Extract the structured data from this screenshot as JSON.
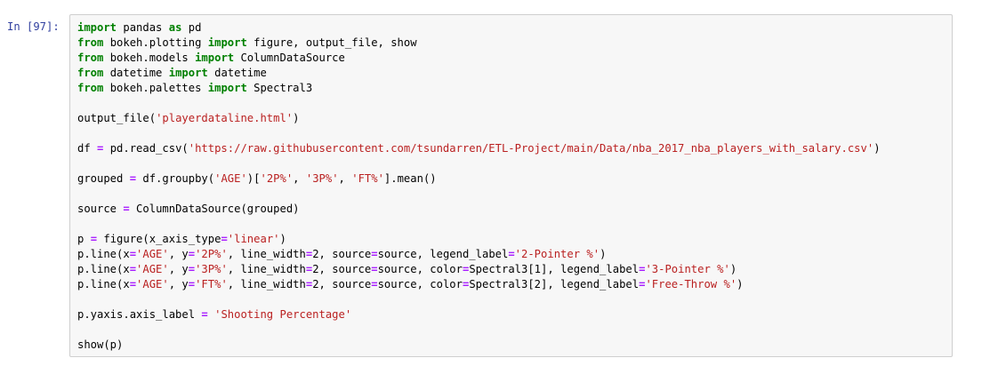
{
  "prompt": "In [97]:",
  "code_lines": [
    {
      "tokens": [
        {
          "t": "import",
          "c": "k"
        },
        {
          "t": " pandas ",
          "c": "n"
        },
        {
          "t": "as",
          "c": "k"
        },
        {
          "t": " pd",
          "c": "n"
        }
      ]
    },
    {
      "tokens": [
        {
          "t": "from",
          "c": "k"
        },
        {
          "t": " bokeh.plotting ",
          "c": "n"
        },
        {
          "t": "import",
          "c": "k"
        },
        {
          "t": " figure, output_file, show",
          "c": "n"
        }
      ]
    },
    {
      "tokens": [
        {
          "t": "from",
          "c": "k"
        },
        {
          "t": " bokeh.models ",
          "c": "n"
        },
        {
          "t": "import",
          "c": "k"
        },
        {
          "t": " ColumnDataSource",
          "c": "n"
        }
      ]
    },
    {
      "tokens": [
        {
          "t": "from",
          "c": "k"
        },
        {
          "t": " datetime ",
          "c": "n"
        },
        {
          "t": "import",
          "c": "k"
        },
        {
          "t": " datetime",
          "c": "n"
        }
      ]
    },
    {
      "tokens": [
        {
          "t": "from",
          "c": "k"
        },
        {
          "t": " bokeh.palettes ",
          "c": "n"
        },
        {
          "t": "import",
          "c": "k"
        },
        {
          "t": " Spectral3",
          "c": "n"
        }
      ]
    },
    {
      "blank": true
    },
    {
      "tokens": [
        {
          "t": "output_file(",
          "c": "n"
        },
        {
          "t": "'playerdataline.html'",
          "c": "s"
        },
        {
          "t": ")",
          "c": "n"
        }
      ]
    },
    {
      "blank": true
    },
    {
      "tokens": [
        {
          "t": "df ",
          "c": "n"
        },
        {
          "t": "=",
          "c": "o"
        },
        {
          "t": " pd.read_csv(",
          "c": "n"
        },
        {
          "t": "'https://raw.githubusercontent.com/tsundarren/ETL-Project/main/Data/nba_2017_nba_players_with_salary.csv'",
          "c": "s"
        },
        {
          "t": ")",
          "c": "n"
        }
      ]
    },
    {
      "blank": true
    },
    {
      "tokens": [
        {
          "t": "grouped ",
          "c": "n"
        },
        {
          "t": "=",
          "c": "o"
        },
        {
          "t": " df.groupby(",
          "c": "n"
        },
        {
          "t": "'AGE'",
          "c": "s"
        },
        {
          "t": ")[",
          "c": "n"
        },
        {
          "t": "'2P%'",
          "c": "s"
        },
        {
          "t": ", ",
          "c": "n"
        },
        {
          "t": "'3P%'",
          "c": "s"
        },
        {
          "t": ", ",
          "c": "n"
        },
        {
          "t": "'FT%'",
          "c": "s"
        },
        {
          "t": "].mean()",
          "c": "n"
        }
      ]
    },
    {
      "blank": true
    },
    {
      "tokens": [
        {
          "t": "source ",
          "c": "n"
        },
        {
          "t": "=",
          "c": "o"
        },
        {
          "t": " ColumnDataSource(grouped)",
          "c": "n"
        }
      ]
    },
    {
      "blank": true
    },
    {
      "tokens": [
        {
          "t": "p ",
          "c": "n"
        },
        {
          "t": "=",
          "c": "o"
        },
        {
          "t": " figure(x_axis_type",
          "c": "n"
        },
        {
          "t": "=",
          "c": "o"
        },
        {
          "t": "'linear'",
          "c": "s"
        },
        {
          "t": ")",
          "c": "n"
        }
      ]
    },
    {
      "tokens": [
        {
          "t": "p.line(x",
          "c": "n"
        },
        {
          "t": "=",
          "c": "o"
        },
        {
          "t": "'AGE'",
          "c": "s"
        },
        {
          "t": ", y",
          "c": "n"
        },
        {
          "t": "=",
          "c": "o"
        },
        {
          "t": "'2P%'",
          "c": "s"
        },
        {
          "t": ", line_width",
          "c": "n"
        },
        {
          "t": "=",
          "c": "o"
        },
        {
          "t": "2",
          "c": "n"
        },
        {
          "t": ", source",
          "c": "n"
        },
        {
          "t": "=",
          "c": "o"
        },
        {
          "t": "source, legend_label",
          "c": "n"
        },
        {
          "t": "=",
          "c": "o"
        },
        {
          "t": "'2-Pointer %'",
          "c": "s"
        },
        {
          "t": ")",
          "c": "n"
        }
      ]
    },
    {
      "tokens": [
        {
          "t": "p.line(x",
          "c": "n"
        },
        {
          "t": "=",
          "c": "o"
        },
        {
          "t": "'AGE'",
          "c": "s"
        },
        {
          "t": ", y",
          "c": "n"
        },
        {
          "t": "=",
          "c": "o"
        },
        {
          "t": "'3P%'",
          "c": "s"
        },
        {
          "t": ", line_width",
          "c": "n"
        },
        {
          "t": "=",
          "c": "o"
        },
        {
          "t": "2",
          "c": "n"
        },
        {
          "t": ", source",
          "c": "n"
        },
        {
          "t": "=",
          "c": "o"
        },
        {
          "t": "source, color",
          "c": "n"
        },
        {
          "t": "=",
          "c": "o"
        },
        {
          "t": "Spectral3[1], legend_label",
          "c": "n"
        },
        {
          "t": "=",
          "c": "o"
        },
        {
          "t": "'3-Pointer %'",
          "c": "s"
        },
        {
          "t": ")",
          "c": "n"
        }
      ]
    },
    {
      "tokens": [
        {
          "t": "p.line(x",
          "c": "n"
        },
        {
          "t": "=",
          "c": "o"
        },
        {
          "t": "'AGE'",
          "c": "s"
        },
        {
          "t": ", y",
          "c": "n"
        },
        {
          "t": "=",
          "c": "o"
        },
        {
          "t": "'FT%'",
          "c": "s"
        },
        {
          "t": ", line_width",
          "c": "n"
        },
        {
          "t": "=",
          "c": "o"
        },
        {
          "t": "2",
          "c": "n"
        },
        {
          "t": ", source",
          "c": "n"
        },
        {
          "t": "=",
          "c": "o"
        },
        {
          "t": "source, color",
          "c": "n"
        },
        {
          "t": "=",
          "c": "o"
        },
        {
          "t": "Spectral3[2], legend_label",
          "c": "n"
        },
        {
          "t": "=",
          "c": "o"
        },
        {
          "t": "'Free-Throw %'",
          "c": "s"
        },
        {
          "t": ")",
          "c": "n"
        }
      ]
    },
    {
      "blank": true
    },
    {
      "tokens": [
        {
          "t": "p.yaxis.axis_label ",
          "c": "n"
        },
        {
          "t": "=",
          "c": "o"
        },
        {
          "t": " ",
          "c": "n"
        },
        {
          "t": "'Shooting Percentage'",
          "c": "s"
        }
      ]
    },
    {
      "blank": true
    },
    {
      "tokens": [
        {
          "t": "show(p)",
          "c": "n"
        }
      ]
    }
  ]
}
